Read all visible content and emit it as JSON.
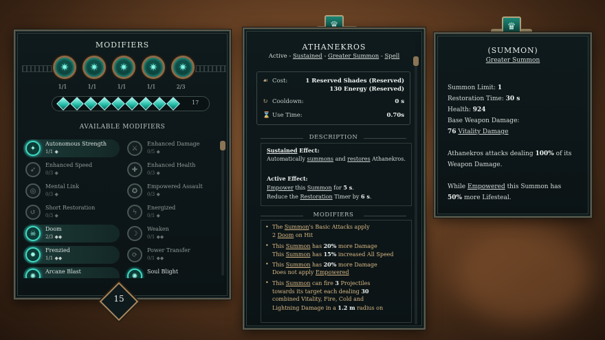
{
  "modifiers_panel": {
    "title": "MODIFIERS",
    "slots": [
      {
        "icon": "arcane-burst-icon",
        "count": "1/1"
      },
      {
        "icon": "arcane-burst-icon",
        "count": "1/1"
      },
      {
        "icon": "arcane-burst-icon",
        "count": "1/1"
      },
      {
        "icon": "arcane-burst-icon",
        "count": "1/1"
      },
      {
        "icon": "arcane-burst-icon",
        "count": "2/3"
      }
    ],
    "gem_count": "17",
    "gems_filled": 9,
    "available_title": "AVAILABLE MODIFIERS",
    "available": [
      {
        "name": "Autonomous Strength",
        "count": "1/1",
        "selected": true
      },
      {
        "name": "Enhanced Damage",
        "count": "0/5",
        "selected": false
      },
      {
        "name": "Enhanced Speed",
        "count": "0/3",
        "selected": false
      },
      {
        "name": "Enhanced Health",
        "count": "0/3",
        "selected": false
      },
      {
        "name": "Mental Link",
        "count": "0/3",
        "selected": false
      },
      {
        "name": "Empowered Assault",
        "count": "0/3",
        "selected": false
      },
      {
        "name": "Short Restoration",
        "count": "0/3",
        "selected": false
      },
      {
        "name": "Energized",
        "count": "0/1",
        "selected": false
      },
      {
        "name": "Doom",
        "count": "2/3",
        "selected": true
      },
      {
        "name": "Weaken",
        "count": "0/1",
        "selected": false
      },
      {
        "name": "Frenzied",
        "count": "1/1",
        "selected": true
      },
      {
        "name": "Power Transfer",
        "count": "0/1",
        "selected": false
      },
      {
        "name": "Arcane Blast",
        "count": "",
        "selected": true
      },
      {
        "name": "Soul Blight",
        "count": "",
        "selected": true
      }
    ],
    "level": "15"
  },
  "skill_panel": {
    "name": "ATHANEKROS",
    "tags": {
      "prefix": "Active - ",
      "t1": "Sustained",
      "sep1": " - ",
      "t2": "Greater Summon",
      "sep2": " - ",
      "t3": "Spell"
    },
    "cost_label": "Cost:",
    "cost_value_1": "1 Reserved Shades (Reserved)",
    "cost_value_2": "130 Energy (Reserved)",
    "cooldown_label": "Cooldown:",
    "cooldown_value": "0 s",
    "usetime_label": "Use Time:",
    "usetime_value": "0.70s",
    "description_title": "DESCRIPTION",
    "desc": {
      "sustained_word": "Sustained",
      "effect_label": " Effect:",
      "line1_a": "Automatically ",
      "line1_b": "summons",
      "line1_c": " and ",
      "line1_d": "restores",
      "line1_e": " Athanekros.",
      "active_effect": "Active Effect:",
      "line2_a": "Empower",
      "line2_b": " this ",
      "line2_c": "Summon",
      "line2_d": " for ",
      "line2_e": "5 s",
      "line2_f": ".",
      "line3_a": "Reduce the ",
      "line3_b": "Restoration",
      "line3_c": " Timer by ",
      "line3_d": "6 s",
      "line3_e": "."
    },
    "modifiers_title": "MODIFIERS",
    "mods": {
      "m1a": "The ",
      "m1b": "Summon",
      "m1c": "'s Basic Attacks apply",
      "m1d": "2 ",
      "m1e": "Doom",
      "m1f": " on Hit",
      "m2a": "This ",
      "m2b": "Summon",
      "m2c": " has ",
      "m2d": "20%",
      "m2e": " more Damage",
      "m2f": "This ",
      "m2g": "Summon",
      "m2h": " has ",
      "m2i": "15%",
      "m2j": " increased All Speed",
      "m3a": "This ",
      "m3b": "Summon",
      "m3c": " has ",
      "m3d": "20%",
      "m3e": " more Damage",
      "m3f": "Does not apply ",
      "m3g": "Empowered",
      "m4a": "This ",
      "m4b": "Summon",
      "m4c": " can fire ",
      "m4d": "3",
      "m4e": " Projectiles",
      "m4f": "towards its target each dealing ",
      "m4g": "30",
      "m4h": "combined Vitality, Fire, Cold and",
      "m4i": "Lightning Damage in a ",
      "m4j": "1.2 m",
      "m4k": " radius on"
    }
  },
  "summon_panel": {
    "title": "(SUMMON)",
    "subtitle": "Greater Summon",
    "limit_label": "Summon Limit: ",
    "limit_value": "1",
    "restore_label": "Restoration Time: ",
    "restore_value": "30 s",
    "health_label": "Health: ",
    "health_value": "924",
    "bwd_label": "Base Weapon Damage:",
    "bwd_value": "76",
    "bwd_type": "Vitality Damage",
    "attack_a": "Athanekros attacks dealing ",
    "attack_b": "100%",
    "attack_c": " of its",
    "attack_d": "Weapon Damage.",
    "while_a": "While ",
    "while_b": "Empowered",
    "while_c": " this Summon has",
    "while_d": "50%",
    "while_e": " more Lifesteal."
  },
  "colors": {
    "accent": "#2fe0c7",
    "gold": "#d8b986",
    "frame": "#8b6b48"
  }
}
